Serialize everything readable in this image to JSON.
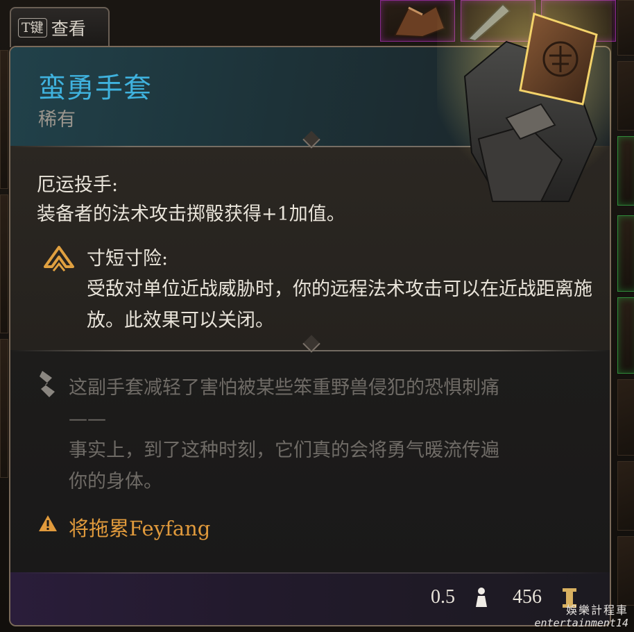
{
  "inspect_tab": {
    "key": "T键",
    "label": "查看"
  },
  "item": {
    "name": "蛮勇手套",
    "rarity": "稀有",
    "name_color": "#3fb2de",
    "icon": "leather-gauntlet-icon"
  },
  "passive": {
    "title": "厄运投手:",
    "description": "装备者的法术攻击掷骰获得+1加值。"
  },
  "reaction": {
    "icon": "reaction-arrow-icon",
    "title": "寸短寸险:",
    "description": "受敌对单位近战威胁时，你的远程法术攻击可以在近战距离施放。此效果可以关闭。"
  },
  "lore": {
    "icon": "feather-quill-icon",
    "lines": [
      "这副手套减轻了害怕被某些笨重野兽侵犯的恐惧刺痛",
      "——",
      "事实上，到了这种时刻，它们真的会将勇气暖流传遍",
      "你的身体。"
    ]
  },
  "warning": {
    "icon": "warning-icon",
    "text": "将拖累Feyfang",
    "color": "#e09a3c"
  },
  "footer": {
    "weight": "0.5",
    "weight_icon": "weight-icon",
    "price": "456",
    "price_icon": "gold-coin-icon"
  },
  "watermark": {
    "line1": "娛樂計程車",
    "line2": "entertainment14"
  }
}
